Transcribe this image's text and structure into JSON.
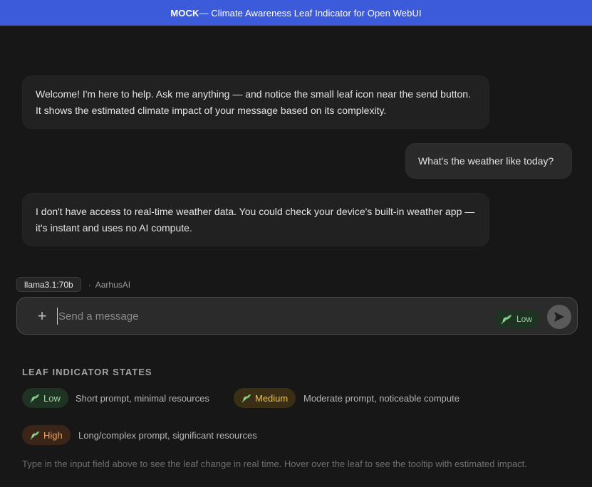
{
  "banner": {
    "prefix": "MOCK",
    "text": " — Climate Awareness Leaf Indicator for Open WebUI"
  },
  "chat": {
    "messages": [
      {
        "role": "assistant",
        "text": "Welcome! I'm here to help. Ask me anything — and notice the small leaf icon near the send button. It shows the estimated climate impact of your message based on its complexity."
      },
      {
        "role": "user",
        "text": "What's the weather like today?"
      },
      {
        "role": "assistant",
        "text": "I don't have access to real-time weather data. You could check your device's built-in weather app — it's instant and uses no AI compute."
      }
    ]
  },
  "model": {
    "name": "llama3.1:70b",
    "separator": "·",
    "owner": "AarhusAI"
  },
  "composer": {
    "plus": "+",
    "placeholder": "Send a message",
    "value": "",
    "leaf_label": "Low",
    "icons": {
      "attach": "plus-icon",
      "leaf": "leaf-icon",
      "send": "send-arrow-icon"
    }
  },
  "states": {
    "title": "LEAF INDICATOR STATES",
    "items": [
      {
        "label": "Low",
        "description": "Short prompt, minimal resources",
        "color": "#9bd69b"
      },
      {
        "label": "Medium",
        "description": "Moderate prompt, noticeable compute",
        "color": "#f0c24a"
      },
      {
        "label": "High",
        "description": "Long/complex prompt, significant resources",
        "color": "#f0a35e"
      }
    ],
    "hint": "Type in the input field above to see the leaf change in real time. Hover over the leaf to see the tooltip with estimated impact."
  },
  "colors": {
    "banner": "#3b5bdb",
    "background": "#171717",
    "leaf_green": "#8fd18f"
  }
}
